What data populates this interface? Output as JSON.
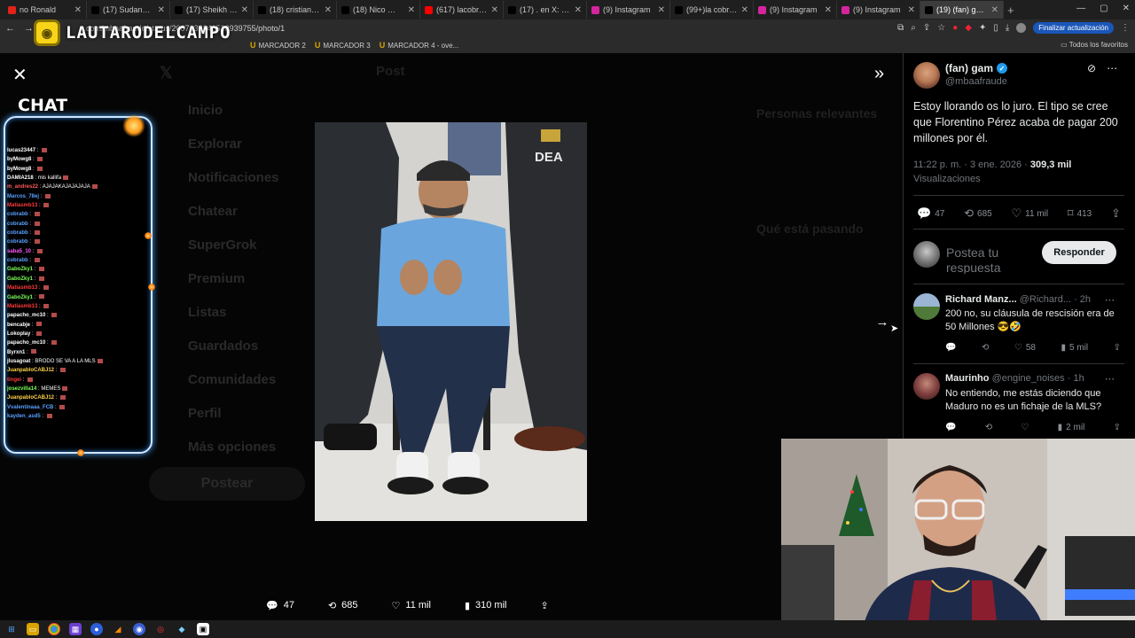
{
  "browser": {
    "tabs": [
      {
        "title": "no Ronald",
        "color": "#e2231a",
        "active": false
      },
      {
        "title": "(17) Sudanalytics en X",
        "color": "#000000",
        "active": false
      },
      {
        "title": "(17) Sheikh Hammad",
        "color": "#000000",
        "active": false
      },
      {
        "title": "(18) cristiano ronaldo",
        "color": "#000000",
        "active": false
      },
      {
        "title": "(18) Nico 🏂 en X: \"in",
        "color": "#000000",
        "active": false
      },
      {
        "title": "(617) lacobra - YouTub",
        "color": "#ff0000",
        "active": false
      },
      {
        "title": "(17) . en X: \"7 ligas en",
        "color": "#000000",
        "active": false
      },
      {
        "title": "(9) Instagram",
        "color": "#d6249f",
        "active": false
      },
      {
        "title": "(99+)la cobra opina s",
        "color": "#000000",
        "active": false
      },
      {
        "title": "(9) Instagram",
        "color": "#d6249f",
        "active": false
      },
      {
        "title": "(9) Instagram",
        "color": "#d6249f",
        "active": false
      },
      {
        "title": "(19) (fan) gam en X: \"E",
        "color": "#000000",
        "active": true
      }
    ],
    "url": "x.com/mbaafraude/status/2007638646518939755/photo/1",
    "update_button": "Finalizar actualización",
    "bookmarks": [
      "MARCADOR 1",
      "MARCADOR 2",
      "MARCADOR 3",
      "MARCADOR 4 - ove..."
    ],
    "all_bookmarks": "Todos los favoritos"
  },
  "overlay": {
    "logo_text": "LAUTARODELCAMPO",
    "chat_title": "CHAT",
    "chat_messages": [
      {
        "user": "lucas23447",
        "msg": "",
        "color": "#ffffff"
      },
      {
        "user": "byMowg8",
        "msg": "",
        "color": "#ffffff"
      },
      {
        "user": "byMowg8",
        "msg": "",
        "color": "#ffffff"
      },
      {
        "user": "DAMIA218",
        "msg": "mis kallifa",
        "color": "#ffffff"
      },
      {
        "user": "m_andres22",
        "msg": "AJAJAKAJAJAJAJA",
        "color": "#ff5a5a"
      },
      {
        "user": "Marcos_78ej",
        "msg": "",
        "color": "#5aa0ff"
      },
      {
        "user": "Matiasmb13",
        "msg": "",
        "color": "#ff3a3a"
      },
      {
        "user": "cobrabb",
        "msg": "",
        "color": "#5aa0ff"
      },
      {
        "user": "cobrabb",
        "msg": "",
        "color": "#5aa0ff"
      },
      {
        "user": "cobrabb",
        "msg": "",
        "color": "#5aa0ff"
      },
      {
        "user": "cobrabb",
        "msg": "",
        "color": "#5aa0ff"
      },
      {
        "user": "saba5_10",
        "msg": "",
        "color": "#ff5aff"
      },
      {
        "user": "cobrabb",
        "msg": "",
        "color": "#5aa0ff"
      },
      {
        "user": "GaboZky1",
        "msg": "",
        "color": "#7dff5a"
      },
      {
        "user": "GaboZky1",
        "msg": "",
        "color": "#7dff5a"
      },
      {
        "user": "Matiasmb13",
        "msg": "",
        "color": "#ff3a3a"
      },
      {
        "user": "GaboZky1",
        "msg": "",
        "color": "#7dff5a"
      },
      {
        "user": "Matiasmb13",
        "msg": "",
        "color": "#ff3a3a"
      },
      {
        "user": "papacho_mc10",
        "msg": "",
        "color": "#ffffff"
      },
      {
        "user": "bencabje",
        "msg": "",
        "color": "#ffffff"
      },
      {
        "user": "Lokoplay",
        "msg": "",
        "color": "#ffffff"
      },
      {
        "user": "papacho_mc10",
        "msg": "",
        "color": "#ffffff"
      },
      {
        "user": "Byrxn1",
        "msg": "",
        "color": "#ffffff"
      },
      {
        "user": "jlusagoat",
        "msg": "BRODO SE VA A LA MLS",
        "color": "#ffffff"
      },
      {
        "user": "JuanpabloCABJ12",
        "msg": "",
        "color": "#ffd24a"
      },
      {
        "user": "tingei",
        "msg": "",
        "color": "#ff3a3a"
      },
      {
        "user": "josezvilla14",
        "msg": "MEMES",
        "color": "#7dff5a"
      },
      {
        "user": "JuanpabloCABJ12",
        "msg": "",
        "color": "#ffd24a"
      },
      {
        "user": "Vvalentinaaa_FCB",
        "msg": "",
        "color": "#5aa0ff"
      },
      {
        "user": "kayden_asd5",
        "msg": "",
        "color": "#5aa0ff"
      }
    ]
  },
  "x_background": {
    "header": "Post",
    "nav": [
      "Inicio",
      "Explorar",
      "Notificaciones",
      "Chatear",
      "SuperGrok",
      "Premium",
      "Listas",
      "Guardados",
      "Comunidades",
      "Perfil",
      "Más opciones"
    ],
    "post_button": "Postear",
    "relevant_title": "Personas relevantes",
    "trending_title": "Qué está pasando"
  },
  "media_viewer": {
    "stats": {
      "replies": "47",
      "reposts": "685",
      "likes": "11 mil",
      "views": "310 mil"
    }
  },
  "tweet": {
    "author_name": "(fan) gam",
    "author_handle": "@mbaafraude",
    "text": "Estoy llorando os lo juro. El tipo se cree que Florentino Pérez acaba de pagar 200 millones por él.",
    "time": "11:22 p. m. · 3 ene. 2026",
    "views_count": "309,3 mil",
    "views_label": "Visualizaciones",
    "stats": {
      "replies": "47",
      "reposts": "685",
      "likes": "11 mil",
      "bookmarks": "413"
    },
    "reply_placeholder": "Postea tu respuesta",
    "reply_button": "Responder"
  },
  "comments": [
    {
      "name": "Richard Manz...",
      "handle": "@Richard...",
      "time": "· 2h",
      "text": "200 no, su cláusula de rescisión era de 50  Millones 😎🤣",
      "likes": "58",
      "views": "5 mil"
    },
    {
      "name": "Maurinho",
      "handle": "@engine_noises",
      "time": "· 1h",
      "text": "No entiendo, me estás diciendo que Maduro no es un fichaje de la MLS?",
      "likes": "",
      "views": "2 mil"
    }
  ]
}
